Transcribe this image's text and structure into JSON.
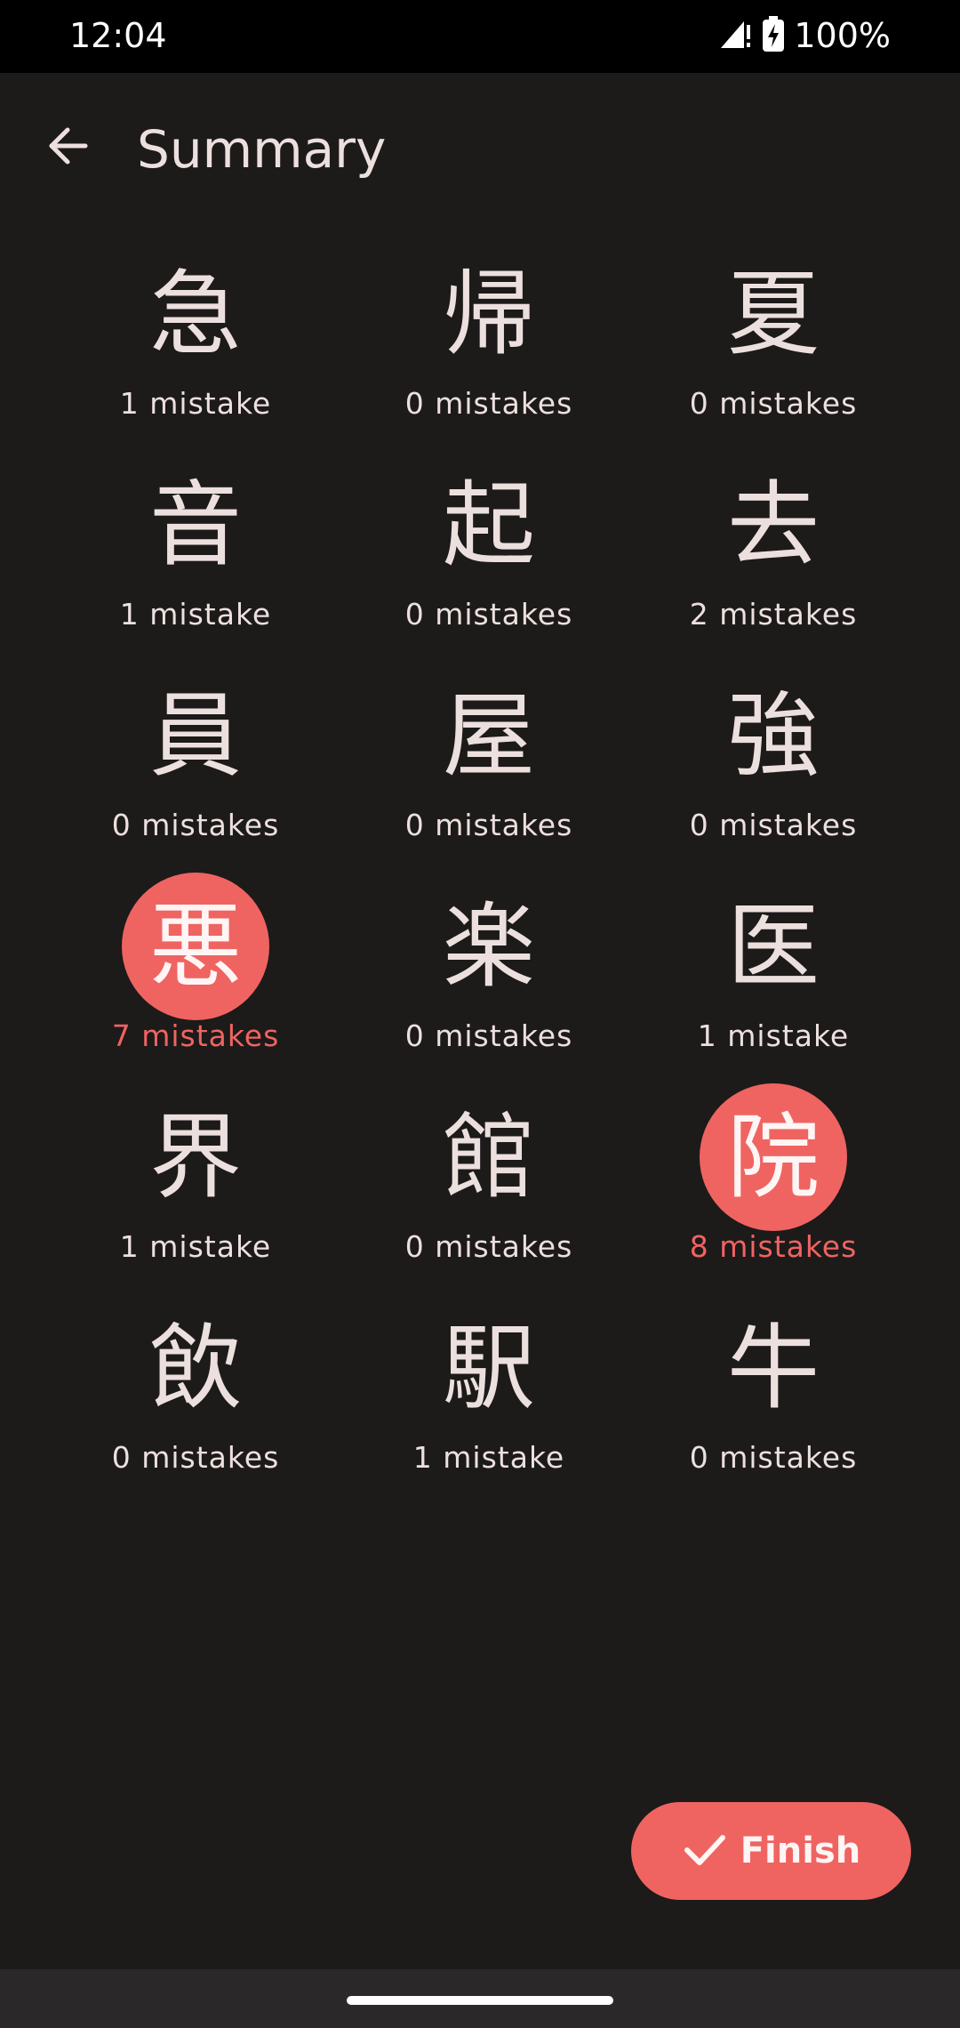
{
  "status_bar": {
    "time": "12:04",
    "battery": "100%",
    "icons": [
      "signal-alert-icon",
      "battery-charging-icon"
    ]
  },
  "app_bar": {
    "title": "Summary",
    "back_icon": "arrow-back-icon"
  },
  "items": [
    {
      "kanji": "急",
      "mistakes": "1 mistake",
      "highlight": false
    },
    {
      "kanji": "帰",
      "mistakes": "0 mistakes",
      "highlight": false
    },
    {
      "kanji": "夏",
      "mistakes": "0 mistakes",
      "highlight": false
    },
    {
      "kanji": "音",
      "mistakes": "1 mistake",
      "highlight": false
    },
    {
      "kanji": "起",
      "mistakes": "0 mistakes",
      "highlight": false
    },
    {
      "kanji": "去",
      "mistakes": "2 mistakes",
      "highlight": false
    },
    {
      "kanji": "員",
      "mistakes": "0 mistakes",
      "highlight": false
    },
    {
      "kanji": "屋",
      "mistakes": "0 mistakes",
      "highlight": false
    },
    {
      "kanji": "強",
      "mistakes": "0 mistakes",
      "highlight": false
    },
    {
      "kanji": "悪",
      "mistakes": "7 mistakes",
      "highlight": true
    },
    {
      "kanji": "楽",
      "mistakes": "0 mistakes",
      "highlight": false
    },
    {
      "kanji": "医",
      "mistakes": "1 mistake",
      "highlight": false
    },
    {
      "kanji": "界",
      "mistakes": "1 mistake",
      "highlight": false
    },
    {
      "kanji": "館",
      "mistakes": "0 mistakes",
      "highlight": false
    },
    {
      "kanji": "院",
      "mistakes": "8 mistakes",
      "highlight": true
    },
    {
      "kanji": "飲",
      "mistakes": "0 mistakes",
      "highlight": false
    },
    {
      "kanji": "駅",
      "mistakes": "1 mistake",
      "highlight": false
    },
    {
      "kanji": "牛",
      "mistakes": "0 mistakes",
      "highlight": false
    }
  ],
  "fab": {
    "label": "Finish",
    "icon": "check-icon"
  },
  "colors": {
    "background": "#1d1a1a",
    "accent": "#ef6461",
    "text": "#ece0df"
  }
}
